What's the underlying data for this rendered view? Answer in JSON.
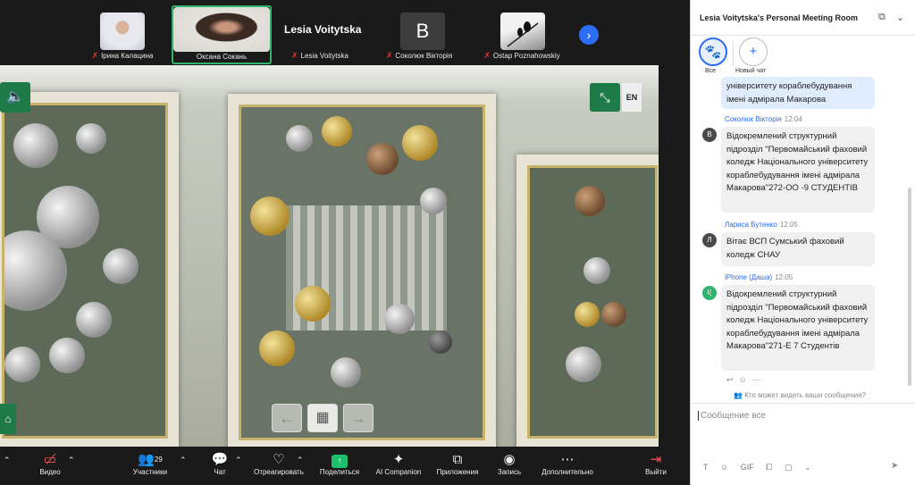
{
  "participants": [
    {
      "name": "Ірина Калацина",
      "muted": true
    },
    {
      "name": "Оксана Сокань",
      "muted": false
    },
    {
      "name": "Lesia Voitytska",
      "muted": true
    },
    {
      "name": "Соколюк Вікторія",
      "muted": true,
      "initial": "B"
    },
    {
      "name": "Ostap Poznahowskiy",
      "muted": true
    }
  ],
  "active_speaker": "Lesia Voitytska",
  "overlay": {
    "lang": "EN"
  },
  "toolbar": {
    "video": "Видео",
    "participants": "Участники",
    "participants_count": "29",
    "chat": "Чат",
    "react": "Отреагировать",
    "share": "Поделиться",
    "companion": "AI Companion",
    "apps": "Приложения",
    "record": "Запись",
    "more": "Дополнительно",
    "leave": "Выйти"
  },
  "chat": {
    "title": "Lesia Voitytska's Personal Meeting Room",
    "all_label": "Все",
    "new_chat_label": "Новый чат",
    "messages": [
      {
        "sender": "",
        "time": "",
        "text": "університету кораблебудування імені адмірала Макарова",
        "own": true
      },
      {
        "sender": "Соколюк Вікторія",
        "time": "12:04",
        "avatar": "В",
        "avatar_color": "#4a4a4a",
        "text": "Відокремлений структурний підрозділ \"Первомайський фаховий коледж Національного університету кораблебудування імені адмірала Макарова\"272-ОО -9 СТУДЕНТІВ"
      },
      {
        "sender": "Лариса Бутенко",
        "time": "12:05",
        "avatar": "Л",
        "avatar_color": "#4a4a4a",
        "text": "Вітає ВСП Сумський фаховий коледж СНАУ"
      },
      {
        "sender": "iPhone (Даша)",
        "time": "12:05",
        "avatar": "I(",
        "avatar_color": "#2fb36d",
        "text": "Відокремлений структурний підрозділ \"Первомайський фаховий коледж Національного університету кораблебудування імені адмірала Макарова\"271-Е 7 Студентів"
      }
    ],
    "who_can_see": "Кто может видеть ваши сообщения?",
    "input_placeholder": "Сообщение все"
  }
}
